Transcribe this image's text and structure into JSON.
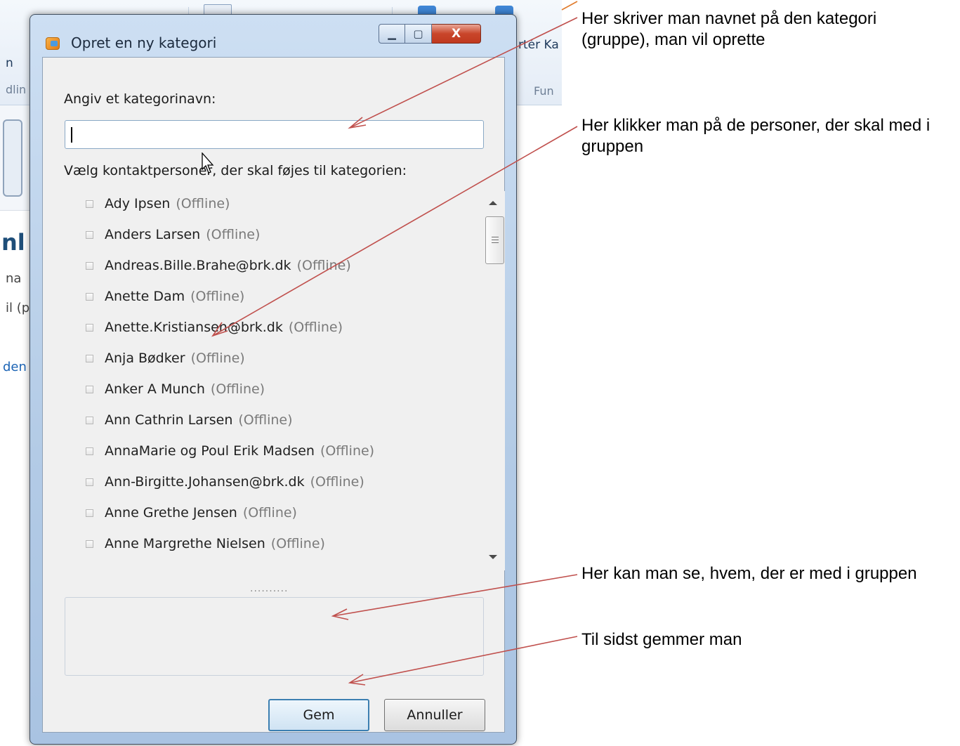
{
  "background_app": {
    "ribbon_fragment_1": "n",
    "ribbon_fragment_2": "dlin",
    "ribbon_fragment_3": "rtér Ka",
    "ribbon_fragment_4": "Fun",
    "side_fragment_1": "nl",
    "side_fragment_2": "na",
    "side_fragment_3": "il (p",
    "side_fragment_4": "den"
  },
  "dialog": {
    "title": "Opret en ny kategori",
    "window_buttons": {
      "minimize": "▁",
      "maximize": "▢",
      "close": "X"
    },
    "name_label": "Angiv et kategorinavn:",
    "name_value": "",
    "contacts_label": "Vælg kontaktpersoner, der skal føjes til kategorien:",
    "contacts": [
      {
        "name": "Ady Ipsen",
        "status": "(Offline)"
      },
      {
        "name": "Anders Larsen",
        "status": "(Offline)"
      },
      {
        "name": "Andreas.Bille.Brahe@brk.dk",
        "status": "(Offline)"
      },
      {
        "name": "Anette Dam",
        "status": "(Offline)"
      },
      {
        "name": "Anette.Kristiansen@brk.dk",
        "status": "(Offline)"
      },
      {
        "name": "Anja Bødker",
        "status": "(Offline)"
      },
      {
        "name": "Anker A Munch",
        "status": "(Offline)"
      },
      {
        "name": "Ann Cathrin Larsen",
        "status": "(Offline)"
      },
      {
        "name": "AnnaMarie og Poul Erik Madsen",
        "status": "(Offline)"
      },
      {
        "name": "Ann-Birgitte.Johansen@brk.dk",
        "status": "(Offline)"
      },
      {
        "name": "Anne Grethe Jensen",
        "status": "(Offline)"
      },
      {
        "name": "Anne Margrethe Nielsen",
        "status": "(Offline)"
      }
    ],
    "splitter": "..........",
    "save_label": "Gem",
    "cancel_label": "Annuller"
  },
  "annotations": {
    "name_hint": "Her skriver man navnet på den kategori (gruppe), man vil oprette",
    "contacts_hint": "Her klikker man på de personer, der skal med i gruppen",
    "members_hint": "Her kan man se, hvem, der er med i gruppen",
    "save_hint": "Til sidst gemmer man"
  },
  "colors": {
    "arrow": "#c0504d",
    "save_button_border": "#3c7fb1",
    "close_button": "#c9452a"
  }
}
